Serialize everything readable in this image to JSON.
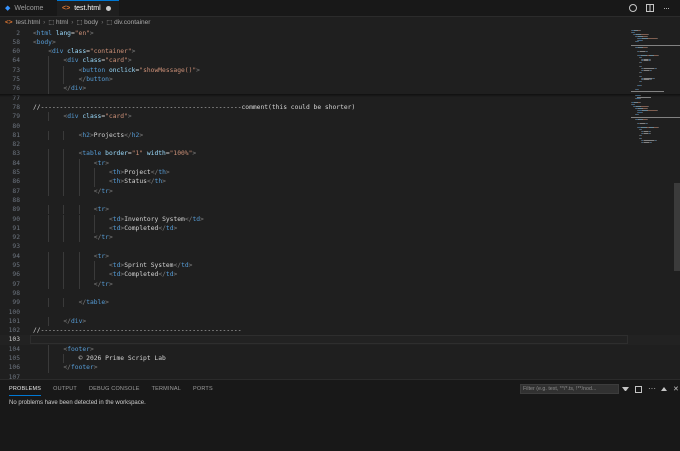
{
  "tabs": [
    {
      "label": "Welcome",
      "icon": "vscode-welcome-icon",
      "active": false
    },
    {
      "label": "test.html",
      "icon": "html-file-icon",
      "active": true,
      "dirty": true
    }
  ],
  "breadcrumb": [
    "test.html",
    "html",
    "body",
    "div.container"
  ],
  "editor": {
    "lines": [
      {
        "n": "2",
        "indent": 0,
        "tokens": [
          [
            "punc",
            "<"
          ],
          [
            "tag",
            "html"
          ],
          [
            "txt",
            " "
          ],
          [
            "attr",
            "lang"
          ],
          [
            "txt",
            "="
          ],
          [
            "str",
            "\"en\""
          ],
          [
            "punc",
            ">"
          ]
        ]
      },
      {
        "n": "58",
        "indent": 0,
        "tokens": [
          [
            "punc",
            "<"
          ],
          [
            "tag",
            "body"
          ],
          [
            "punc",
            ">"
          ]
        ]
      },
      {
        "n": "60",
        "indent": 1,
        "tokens": [
          [
            "punc",
            "<"
          ],
          [
            "tag",
            "div"
          ],
          [
            "txt",
            " "
          ],
          [
            "attr",
            "class"
          ],
          [
            "txt",
            "="
          ],
          [
            "str",
            "\"container\""
          ],
          [
            "punc",
            ">"
          ]
        ]
      },
      {
        "n": "64",
        "indent": 2,
        "tokens": [
          [
            "punc",
            "<"
          ],
          [
            "tag",
            "div"
          ],
          [
            "txt",
            " "
          ],
          [
            "attr",
            "class"
          ],
          [
            "txt",
            "="
          ],
          [
            "str",
            "\"card\""
          ],
          [
            "punc",
            ">"
          ]
        ]
      },
      {
        "n": "73",
        "indent": 3,
        "tokens": [
          [
            "punc",
            "<"
          ],
          [
            "tag",
            "button"
          ],
          [
            "txt",
            " "
          ],
          [
            "attr",
            "onclick"
          ],
          [
            "txt",
            "="
          ],
          [
            "str",
            "\"showMessage()\""
          ],
          [
            "punc",
            ">"
          ]
        ]
      },
      {
        "n": "75",
        "indent": 3,
        "tokens": [
          [
            "punc",
            "</"
          ],
          [
            "tag",
            "button"
          ],
          [
            "punc",
            ">"
          ]
        ]
      },
      {
        "n": "76",
        "indent": 2,
        "tokens": [
          [
            "punc",
            "</"
          ],
          [
            "tag",
            "div"
          ],
          [
            "punc",
            ">"
          ]
        ]
      },
      {
        "n": "77",
        "indent": 0,
        "tokens": []
      },
      {
        "n": "78",
        "indent": 0,
        "tokens": [
          [
            "txt",
            "//-----------------------------------------------------comment(this could be shorter)"
          ]
        ]
      },
      {
        "n": "79",
        "indent": 2,
        "tokens": [
          [
            "punc",
            "<"
          ],
          [
            "tag",
            "div"
          ],
          [
            "txt",
            " "
          ],
          [
            "attr",
            "class"
          ],
          [
            "txt",
            "="
          ],
          [
            "str",
            "\"card\""
          ],
          [
            "punc",
            ">"
          ]
        ]
      },
      {
        "n": "80",
        "indent": 0,
        "tokens": []
      },
      {
        "n": "81",
        "indent": 3,
        "tokens": [
          [
            "punc",
            "<"
          ],
          [
            "tag",
            "h2"
          ],
          [
            "punc",
            ">"
          ],
          [
            "txt",
            "Projects"
          ],
          [
            "punc",
            "</"
          ],
          [
            "tag",
            "h2"
          ],
          [
            "punc",
            ">"
          ]
        ]
      },
      {
        "n": "82",
        "indent": 0,
        "tokens": []
      },
      {
        "n": "83",
        "indent": 3,
        "tokens": [
          [
            "punc",
            "<"
          ],
          [
            "tag",
            "table"
          ],
          [
            "txt",
            " "
          ],
          [
            "attr",
            "border"
          ],
          [
            "txt",
            "="
          ],
          [
            "str",
            "\"1\""
          ],
          [
            "txt",
            " "
          ],
          [
            "attr",
            "width"
          ],
          [
            "txt",
            "="
          ],
          [
            "str",
            "\"100%\""
          ],
          [
            "punc",
            ">"
          ]
        ]
      },
      {
        "n": "84",
        "indent": 4,
        "tokens": [
          [
            "punc",
            "<"
          ],
          [
            "tag",
            "tr"
          ],
          [
            "punc",
            ">"
          ]
        ]
      },
      {
        "n": "85",
        "indent": 5,
        "tokens": [
          [
            "punc",
            "<"
          ],
          [
            "tag",
            "th"
          ],
          [
            "punc",
            ">"
          ],
          [
            "txt",
            "Project"
          ],
          [
            "punc",
            "</"
          ],
          [
            "tag",
            "th"
          ],
          [
            "punc",
            ">"
          ]
        ]
      },
      {
        "n": "86",
        "indent": 5,
        "tokens": [
          [
            "punc",
            "<"
          ],
          [
            "tag",
            "th"
          ],
          [
            "punc",
            ">"
          ],
          [
            "txt",
            "Status"
          ],
          [
            "punc",
            "</"
          ],
          [
            "tag",
            "th"
          ],
          [
            "punc",
            ">"
          ]
        ]
      },
      {
        "n": "87",
        "indent": 4,
        "tokens": [
          [
            "punc",
            "</"
          ],
          [
            "tag",
            "tr"
          ],
          [
            "punc",
            ">"
          ]
        ]
      },
      {
        "n": "88",
        "indent": 0,
        "tokens": []
      },
      {
        "n": "89",
        "indent": 4,
        "tokens": [
          [
            "punc",
            "<"
          ],
          [
            "tag",
            "tr"
          ],
          [
            "punc",
            ">"
          ]
        ]
      },
      {
        "n": "90",
        "indent": 5,
        "tokens": [
          [
            "punc",
            "<"
          ],
          [
            "tag",
            "td"
          ],
          [
            "punc",
            ">"
          ],
          [
            "txt",
            "Inventory System"
          ],
          [
            "punc",
            "</"
          ],
          [
            "tag",
            "td"
          ],
          [
            "punc",
            ">"
          ]
        ]
      },
      {
        "n": "91",
        "indent": 5,
        "tokens": [
          [
            "punc",
            "<"
          ],
          [
            "tag",
            "td"
          ],
          [
            "punc",
            ">"
          ],
          [
            "txt",
            "Completed"
          ],
          [
            "punc",
            "</"
          ],
          [
            "tag",
            "td"
          ],
          [
            "punc",
            ">"
          ]
        ]
      },
      {
        "n": "92",
        "indent": 4,
        "tokens": [
          [
            "punc",
            "</"
          ],
          [
            "tag",
            "tr"
          ],
          [
            "punc",
            ">"
          ]
        ]
      },
      {
        "n": "93",
        "indent": 0,
        "tokens": []
      },
      {
        "n": "94",
        "indent": 4,
        "tokens": [
          [
            "punc",
            "<"
          ],
          [
            "tag",
            "tr"
          ],
          [
            "punc",
            ">"
          ]
        ]
      },
      {
        "n": "95",
        "indent": 5,
        "tokens": [
          [
            "punc",
            "<"
          ],
          [
            "tag",
            "td"
          ],
          [
            "punc",
            ">"
          ],
          [
            "txt",
            "Sprint System"
          ],
          [
            "punc",
            "</"
          ],
          [
            "tag",
            "td"
          ],
          [
            "punc",
            ">"
          ]
        ]
      },
      {
        "n": "96",
        "indent": 5,
        "tokens": [
          [
            "punc",
            "<"
          ],
          [
            "tag",
            "td"
          ],
          [
            "punc",
            ">"
          ],
          [
            "txt",
            "Completed"
          ],
          [
            "punc",
            "</"
          ],
          [
            "tag",
            "td"
          ],
          [
            "punc",
            ">"
          ]
        ]
      },
      {
        "n": "97",
        "indent": 4,
        "tokens": [
          [
            "punc",
            "</"
          ],
          [
            "tag",
            "tr"
          ],
          [
            "punc",
            ">"
          ]
        ]
      },
      {
        "n": "98",
        "indent": 0,
        "tokens": []
      },
      {
        "n": "99",
        "indent": 3,
        "tokens": [
          [
            "punc",
            "</"
          ],
          [
            "tag",
            "table"
          ],
          [
            "punc",
            ">"
          ]
        ]
      },
      {
        "n": "100",
        "indent": 0,
        "tokens": []
      },
      {
        "n": "101",
        "indent": 2,
        "tokens": [
          [
            "punc",
            "</"
          ],
          [
            "tag",
            "div"
          ],
          [
            "punc",
            ">"
          ]
        ]
      },
      {
        "n": "102",
        "indent": 0,
        "tokens": [
          [
            "txt",
            "//-----------------------------------------------------"
          ]
        ]
      },
      {
        "n": "103",
        "indent": 0,
        "tokens": [],
        "current": true
      },
      {
        "n": "104",
        "indent": 2,
        "tokens": [
          [
            "punc",
            "<"
          ],
          [
            "tag",
            "footer"
          ],
          [
            "punc",
            ">"
          ]
        ]
      },
      {
        "n": "105",
        "indent": 3,
        "tokens": [
          [
            "txt",
            "© 2026 Prime Script Lab"
          ]
        ]
      },
      {
        "n": "106",
        "indent": 2,
        "tokens": [
          [
            "punc",
            "</"
          ],
          [
            "tag",
            "footer"
          ],
          [
            "punc",
            ">"
          ]
        ]
      },
      {
        "n": "107",
        "indent": 0,
        "tokens": []
      }
    ]
  },
  "colors": {
    "tag": "#569cd6",
    "attr": "#9cdcfe",
    "str": "#ce9178",
    "punc": "#808080",
    "txt": "#d4d4d4",
    "accent": "#0078d4"
  },
  "panel": {
    "tabs": [
      "PROBLEMS",
      "OUTPUT",
      "DEBUG CONSOLE",
      "TERMINAL",
      "PORTS"
    ],
    "active_tab": "PROBLEMS",
    "filter_placeholder": "Filter (e.g. text, **/*.ts, !**/nod...",
    "message": "No problems have been detected in the workspace."
  }
}
